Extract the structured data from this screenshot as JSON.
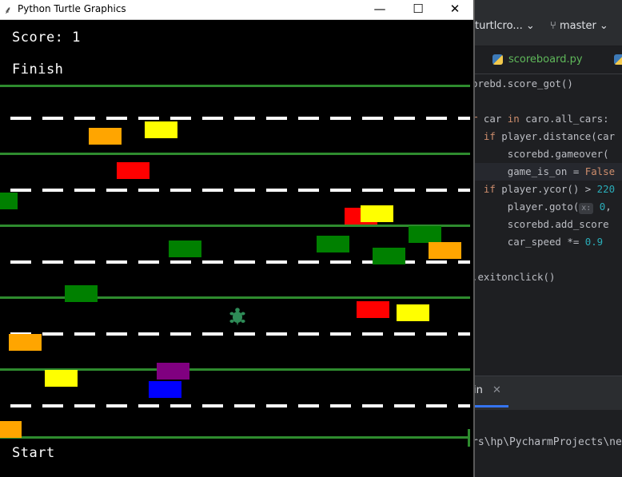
{
  "turtle_window": {
    "title": "Python Turtle Graphics",
    "controls": {
      "minimize": "—",
      "maximize": "☐",
      "close": "✕"
    }
  },
  "game": {
    "score_text": "Score: 1",
    "finish_label": "Finish",
    "start_label": "Start",
    "colors": {
      "lane_line": "#2e8b2e",
      "dash": "#ffffff",
      "background": "#000000"
    },
    "cars": [
      {
        "color": "orange"
      },
      {
        "color": "yellow"
      },
      {
        "color": "red"
      },
      {
        "color": "green"
      },
      {
        "color": "red"
      },
      {
        "color": "yellow"
      },
      {
        "color": "green"
      },
      {
        "color": "green"
      },
      {
        "color": "green"
      },
      {
        "color": "green"
      },
      {
        "color": "orange"
      },
      {
        "color": "green"
      },
      {
        "color": "red"
      },
      {
        "color": "yellow"
      },
      {
        "color": "orange"
      },
      {
        "color": "yellow"
      },
      {
        "color": "purple"
      },
      {
        "color": "blue"
      },
      {
        "color": "orange"
      }
    ],
    "player": {
      "shape": "turtle",
      "color": "#2e8b57"
    }
  },
  "ide": {
    "project_name": "turtlcro...",
    "branch": "master",
    "open_tab": "scoreboard.py",
    "code_lines": [
      {
        "text": "orebd.score_got()"
      },
      {
        "text": ""
      },
      {
        "text": "r car in caro.all_cars:"
      },
      {
        "text": "  if player.distance(car"
      },
      {
        "text": "      scorebd.gameover("
      },
      {
        "text": "      game_is_on = False"
      },
      {
        "text": "  if player.ycor() > 220"
      },
      {
        "text": "      player.goto(  0, "
      },
      {
        "text": "      scorebd.add_score"
      },
      {
        "text": "      car_speed *= 0.9"
      },
      {
        "text": ""
      },
      {
        "text": ".exitonclick()"
      }
    ],
    "run_tab": "in",
    "console_path": "rs\\hp\\PycharmProjects\\ne"
  }
}
